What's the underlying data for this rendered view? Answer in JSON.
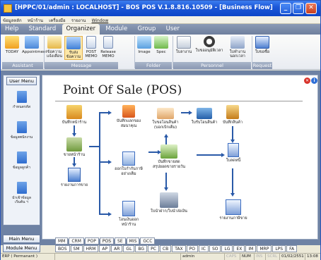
{
  "window": {
    "title": "[HPPC/01/admin : LOCALHOST] - BOS POS V.1.8.816.10509 - [Business Flow]",
    "minimize": "_",
    "restore": "❐",
    "close": "✕"
  },
  "menubar": [
    "ข้อมูลหลัก",
    "หน้าร้าน",
    "เครื่องมือ",
    "รายงาน",
    "Window"
  ],
  "ribbon_tabs": [
    "Help",
    "Standard",
    "Organizer",
    "Module",
    "Group",
    "User"
  ],
  "ribbon_active_tab": "Organizer",
  "ribbon": {
    "assistant": {
      "label": "Assistant",
      "buttons": [
        "TODAY",
        "Appointment"
      ]
    },
    "message": {
      "label": "Message",
      "buttons": [
        "ข้อความ\nแจ้งเตือน",
        "รับส่ง\nข้อความ",
        "POST\nMEMO",
        "Release\nMEMO"
      ]
    },
    "folder": {
      "label": "Folder",
      "buttons": [
        "Image",
        "Spec"
      ]
    },
    "personnel": {
      "label": "Personnel",
      "buttons": [
        "ใบลางาน",
        "ใบขออนุมัติเวลา",
        "ใบทำงาน\nนอกเวลา"
      ]
    },
    "request": {
      "label": "Request",
      "buttons": [
        "ใบขอซื้อ"
      ]
    }
  },
  "sidebar": {
    "header": "User Menu",
    "items": [
      "กำหนดรหัส",
      "ข้อมูลพนักงาน",
      "ข้อมูลลูกค้า",
      "นำเข้าข้อมูล\nเริ่มต้น ฯ"
    ],
    "main_menu": "Main Menu",
    "module_menu": "Module Menu"
  },
  "flow": {
    "title": "Point Of Sale (POS)",
    "nodes": {
      "front": "บันทึกหน้าร้าน",
      "sell": "ขายหน้าร้าน",
      "report_sales": "รายงานการขาย",
      "gift": "บันทึกแลกของ\nสมนาคุณ",
      "tax_full": "ออกใบกำกับภาษี\nอย่างเต็ม",
      "transfer_out": "โอนเงินออก\nหน้าร้าน",
      "request_goods": "ใบขอโอนสินค้า\n(บอกเบิกเต็ม)",
      "transfer_goods": "ใบรับโอนสินค้า",
      "record_sale": "บันทึกขายสด\nสรุปยอดขายรายวัน",
      "deposit": "ใบนำฝาก/ใบนำส่งเงิน",
      "receive_goods": "บันทึกสินค้า",
      "invoice": "ใบลดหนี้",
      "report_tax": "รายงานภาษีขาย"
    }
  },
  "bottom_tabs_row1": [
    "MM",
    "CRM",
    "POP",
    "POS",
    "SE",
    "MIS",
    "GCC"
  ],
  "bottom_tabs_row2": [
    "BOS",
    "SM",
    "HRM",
    "AP",
    "AR",
    "GL",
    "BG",
    "PC",
    "CB",
    "TAX",
    "PO",
    "IC",
    "SO",
    "LG",
    "EX",
    "IM",
    "MRP",
    "LPS",
    "FA"
  ],
  "bottom_tab_selected": "POS",
  "status": {
    "mode": "ERP ( Permanant )",
    "user": "admin",
    "caps": "CAPS",
    "num": "NUM",
    "ins": "INS",
    "scrl": "SCRL",
    "date": "01/02/2551",
    "time": "13:08"
  },
  "colors": {
    "title_blue": "#1d58d8",
    "flow_arrow": "#2a5aa8",
    "panel_bg": "#6e82a4"
  }
}
